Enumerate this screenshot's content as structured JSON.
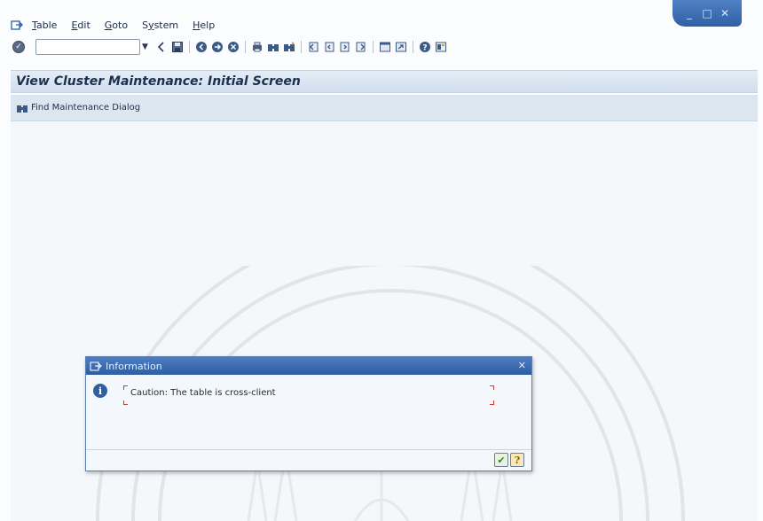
{
  "window_controls": {
    "minimize": "_",
    "maximize": "□",
    "close": "✕"
  },
  "menu": {
    "items": [
      {
        "label": "Table",
        "mnemonic": "T"
      },
      {
        "label": "Edit",
        "mnemonic": "E"
      },
      {
        "label": "Goto",
        "mnemonic": "G"
      },
      {
        "label": "System",
        "mnemonic": "y"
      },
      {
        "label": "Help",
        "mnemonic": "H"
      }
    ]
  },
  "toolbar": {
    "command_field_value": "",
    "icons": [
      "enter-icon",
      "back-icon",
      "save-icon",
      "back-green-icon",
      "exit-icon",
      "cancel-icon",
      "print-icon",
      "find-icon",
      "find-next-icon",
      "first-page-icon",
      "previous-page-icon",
      "next-page-icon",
      "last-page-icon",
      "create-session-icon",
      "shortcut-icon",
      "help-icon",
      "layout-icon"
    ]
  },
  "title": "View Cluster Maintenance: Initial Screen",
  "app_toolbar": {
    "find_dialog_label": "Find Maintenance Dialog"
  },
  "dialog": {
    "title": "Information",
    "close_glyph": "✕",
    "message": "Caution: The table is cross-client",
    "buttons": {
      "ok_glyph": "✔",
      "help_glyph": "?"
    }
  },
  "colors": {
    "accent": "#2f5fa4",
    "title_bar": "#d1deeb",
    "app_toolbar": "#dbe6f1",
    "message_frame": "#d23a2a"
  }
}
